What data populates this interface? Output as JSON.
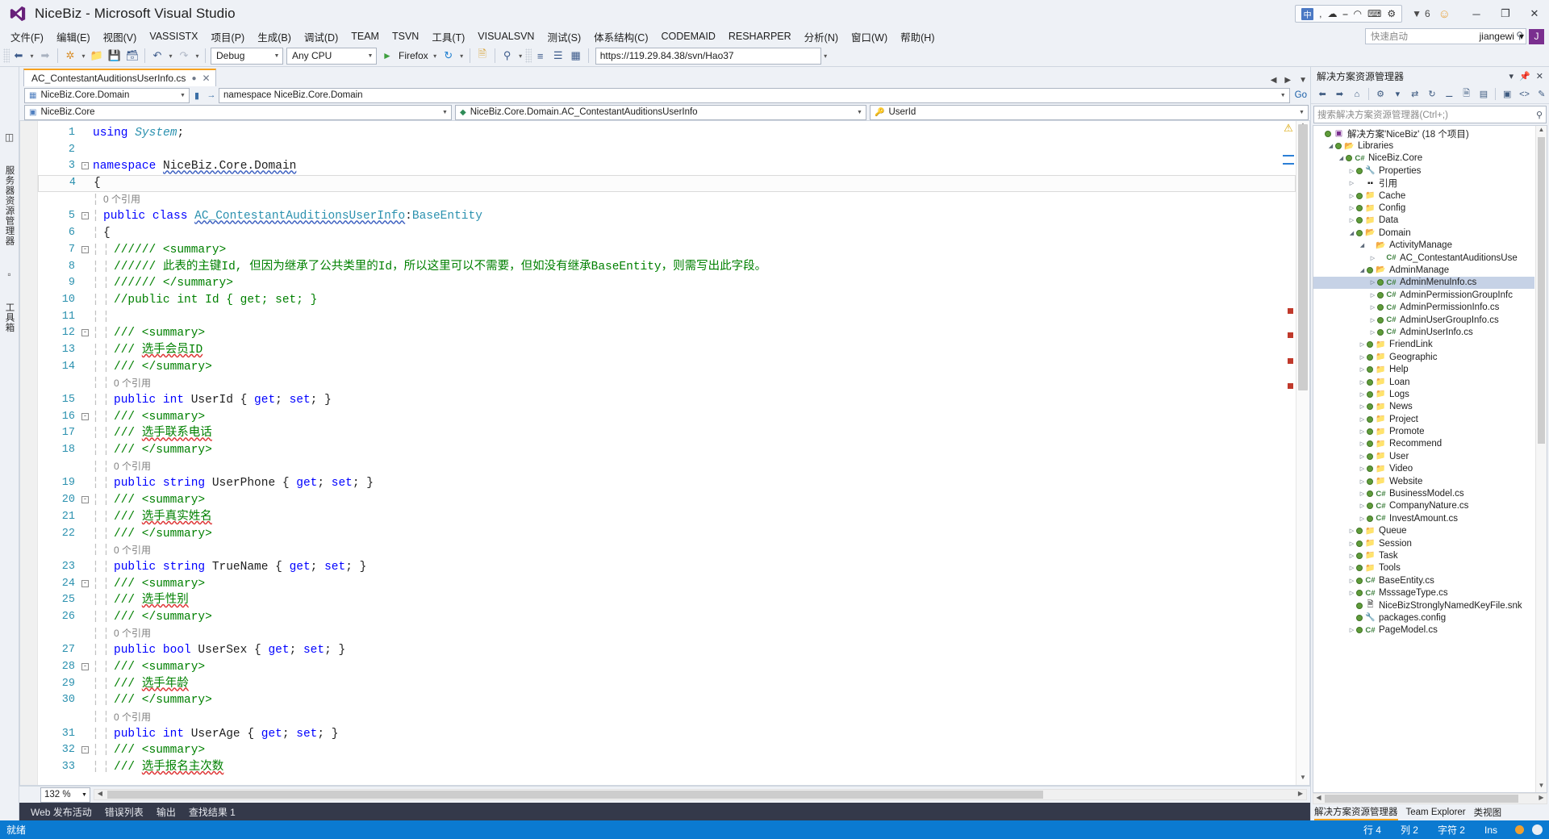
{
  "window": {
    "title": "NiceBiz - Microsoft Visual Studio",
    "logo_icon": "visual-studio-logo",
    "notification_count": "6",
    "feedback_icon": "smiley-icon",
    "minimize_label": "─",
    "maximize_label": "❐",
    "close_label": "✕",
    "ime": {
      "lang_square": "中",
      "items": [
        "中",
        ",",
        "☁",
        "▭",
        "⌽",
        "⛃",
        "⌨"
      ]
    }
  },
  "menu": {
    "items": [
      "文件(F)",
      "编辑(E)",
      "视图(V)",
      "VASSISTX",
      "项目(P)",
      "生成(B)",
      "调试(D)",
      "TEAM",
      "TSVN",
      "工具(T)",
      "VISUALSVN",
      "测试(S)",
      "体系结构(C)",
      "CODEMAID",
      "RESHARPER",
      "分析(N)",
      "窗口(W)",
      "帮助(H)"
    ],
    "quick_launch_placeholder": "快速启动",
    "quick_launch_icon": "search-icon",
    "user_name": "jiangewi",
    "user_avatar_letter": "J",
    "user_caret": "▾"
  },
  "toolbar": {
    "back_icon": "navigate-back-icon",
    "forward_icon": "navigate-forward-icon",
    "new_project_icon": "new-project-icon",
    "open_icon": "open-file-icon",
    "save_icon": "save-icon",
    "save_all_icon": "save-all-icon",
    "undo_icon": "undo-icon",
    "redo_icon": "redo-icon",
    "config_value": "Debug",
    "platform_value": "Any CPU",
    "start_label": "Firefox",
    "start_icon": "run-play-icon",
    "refresh_icon": "refresh-icon",
    "url_value": "https://119.29.84.38/svn/Hao37",
    "misc_icons": [
      "step-icon",
      "find-icon",
      "comment-icon",
      "uncomment-icon",
      "indent-icon",
      "outdent-icon",
      "bookmark-icon",
      "panel-icon",
      "grid-icon"
    ]
  },
  "leftrail": {
    "items": [
      {
        "label": "服务器资源管理器",
        "icon": "server-explorer-icon"
      },
      {
        "label": "工具箱",
        "icon": "toolbox-icon"
      }
    ]
  },
  "tabs": {
    "active": {
      "label": "AC_ContestantAuditionsUserInfo.cs",
      "pin_icon": "pin-icon",
      "close_icon": "close-icon"
    },
    "right_controls": [
      "scroll-left-icon",
      "scroll-right-icon",
      "tab-list-icon"
    ]
  },
  "navbars": {
    "project_value": "NiceBiz.Core.Domain",
    "project_icon": "project-icon",
    "member_value": "namespace NiceBiz.Core.Domain",
    "member_arrow": "→",
    "go_label": "Go",
    "scope_value": "NiceBiz.Core",
    "scope_icon": "assembly-icon",
    "type_value": "NiceBiz.Core.Domain.AC_ContestantAuditionsUserInfo",
    "type_icon": "class-icon",
    "symbol_value": "UserId",
    "symbol_icon": "property-icon"
  },
  "editor": {
    "zoom_level": "132 %",
    "lines": [
      {
        "n": "1",
        "fold": "",
        "indent": 0,
        "tokens": [
          {
            "t": "using ",
            "c": "kw"
          },
          {
            "t": "System",
            "c": "typ ital"
          },
          {
            "t": ";",
            "c": "usr"
          }
        ]
      },
      {
        "n": "2",
        "fold": "",
        "indent": 0,
        "tokens": []
      },
      {
        "n": "3",
        "fold": "-",
        "indent": 0,
        "tokens": [
          {
            "t": "namespace ",
            "c": "kw"
          },
          {
            "t": "NiceBiz.Core.Domain",
            "c": "usr squiggle"
          }
        ]
      },
      {
        "n": "4",
        "fold": "",
        "indent": 0,
        "tokens": [
          {
            "t": "{",
            "c": "usr"
          }
        ],
        "current": true
      },
      {
        "n": "",
        "fold": "",
        "indent": 1,
        "ref": "0 个引用"
      },
      {
        "n": "5",
        "fold": "-",
        "indent": 1,
        "tokens": [
          {
            "t": "public class ",
            "c": "kw"
          },
          {
            "t": "AC_ContestantAuditionsUserInfo",
            "c": "typ squiggle"
          },
          {
            "t": ":",
            "c": "usr"
          },
          {
            "t": "BaseEntity",
            "c": "typ"
          }
        ]
      },
      {
        "n": "6",
        "fold": "",
        "indent": 1,
        "tokens": [
          {
            "t": "{",
            "c": "usr"
          }
        ]
      },
      {
        "n": "7",
        "fold": "-",
        "indent": 2,
        "tokens": [
          {
            "t": "////// <summary>",
            "c": "cmt"
          }
        ]
      },
      {
        "n": "8",
        "fold": "",
        "indent": 2,
        "tokens": [
          {
            "t": "////// 此表的主键Id, 但因为继承了公共类里的Id，所以这里可以不需要，但如没有继承BaseEntity，则需写出此字段。",
            "c": "cmt"
          }
        ]
      },
      {
        "n": "9",
        "fold": "",
        "indent": 2,
        "tokens": [
          {
            "t": "////// </summary>",
            "c": "cmt"
          }
        ]
      },
      {
        "n": "10",
        "fold": "",
        "indent": 2,
        "tokens": [
          {
            "t": "//public int Id { get; set; }",
            "c": "cmt"
          }
        ]
      },
      {
        "n": "11",
        "fold": "",
        "indent": 2,
        "tokens": []
      },
      {
        "n": "12",
        "fold": "-",
        "indent": 2,
        "tokens": [
          {
            "t": "/// <summary>",
            "c": "cmt"
          }
        ]
      },
      {
        "n": "13",
        "fold": "",
        "indent": 2,
        "tokens": [
          {
            "t": "/// ",
            "c": "cmt"
          },
          {
            "t": "选手会员ID",
            "c": "cmt squiggle-red"
          }
        ]
      },
      {
        "n": "14",
        "fold": "",
        "indent": 2,
        "tokens": [
          {
            "t": "/// </summary>",
            "c": "cmt"
          }
        ]
      },
      {
        "n": "",
        "fold": "",
        "indent": 2,
        "ref": "0 个引用"
      },
      {
        "n": "15",
        "fold": "",
        "indent": 2,
        "tokens": [
          {
            "t": "public int ",
            "c": "kw"
          },
          {
            "t": "UserId",
            "c": "usr"
          },
          {
            "t": " { ",
            "c": "usr"
          },
          {
            "t": "get",
            "c": "kw"
          },
          {
            "t": "; ",
            "c": "usr"
          },
          {
            "t": "set",
            "c": "kw"
          },
          {
            "t": "; }",
            "c": "usr"
          }
        ]
      },
      {
        "n": "16",
        "fold": "-",
        "indent": 2,
        "tokens": [
          {
            "t": "/// <summary>",
            "c": "cmt"
          }
        ]
      },
      {
        "n": "17",
        "fold": "",
        "indent": 2,
        "tokens": [
          {
            "t": "/// ",
            "c": "cmt"
          },
          {
            "t": "选手联系电话",
            "c": "cmt squiggle-red"
          }
        ]
      },
      {
        "n": "18",
        "fold": "",
        "indent": 2,
        "tokens": [
          {
            "t": "/// </summary>",
            "c": "cmt"
          }
        ]
      },
      {
        "n": "",
        "fold": "",
        "indent": 2,
        "ref": "0 个引用"
      },
      {
        "n": "19",
        "fold": "",
        "indent": 2,
        "tokens": [
          {
            "t": "public string ",
            "c": "kw"
          },
          {
            "t": "UserPhone",
            "c": "usr"
          },
          {
            "t": " { ",
            "c": "usr"
          },
          {
            "t": "get",
            "c": "kw"
          },
          {
            "t": "; ",
            "c": "usr"
          },
          {
            "t": "set",
            "c": "kw"
          },
          {
            "t": "; }",
            "c": "usr"
          }
        ]
      },
      {
        "n": "20",
        "fold": "-",
        "indent": 2,
        "tokens": [
          {
            "t": "/// <summary>",
            "c": "cmt"
          }
        ]
      },
      {
        "n": "21",
        "fold": "",
        "indent": 2,
        "tokens": [
          {
            "t": "/// ",
            "c": "cmt"
          },
          {
            "t": "选手真实姓名",
            "c": "cmt squiggle-red"
          }
        ]
      },
      {
        "n": "22",
        "fold": "",
        "indent": 2,
        "tokens": [
          {
            "t": "/// </summary>",
            "c": "cmt"
          }
        ]
      },
      {
        "n": "",
        "fold": "",
        "indent": 2,
        "ref": "0 个引用"
      },
      {
        "n": "23",
        "fold": "",
        "indent": 2,
        "tokens": [
          {
            "t": "public string ",
            "c": "kw"
          },
          {
            "t": "TrueName",
            "c": "usr"
          },
          {
            "t": " { ",
            "c": "usr"
          },
          {
            "t": "get",
            "c": "kw"
          },
          {
            "t": "; ",
            "c": "usr"
          },
          {
            "t": "set",
            "c": "kw"
          },
          {
            "t": "; }",
            "c": "usr"
          }
        ]
      },
      {
        "n": "24",
        "fold": "-",
        "indent": 2,
        "tokens": [
          {
            "t": "/// <summary>",
            "c": "cmt"
          }
        ]
      },
      {
        "n": "25",
        "fold": "",
        "indent": 2,
        "tokens": [
          {
            "t": "/// ",
            "c": "cmt"
          },
          {
            "t": "选手性别",
            "c": "cmt squiggle-red"
          }
        ]
      },
      {
        "n": "26",
        "fold": "",
        "indent": 2,
        "tokens": [
          {
            "t": "/// </summary>",
            "c": "cmt"
          }
        ]
      },
      {
        "n": "",
        "fold": "",
        "indent": 2,
        "ref": "0 个引用"
      },
      {
        "n": "27",
        "fold": "",
        "indent": 2,
        "tokens": [
          {
            "t": "public bool ",
            "c": "kw"
          },
          {
            "t": "UserSex",
            "c": "usr"
          },
          {
            "t": " { ",
            "c": "usr"
          },
          {
            "t": "get",
            "c": "kw"
          },
          {
            "t": "; ",
            "c": "usr"
          },
          {
            "t": "set",
            "c": "kw"
          },
          {
            "t": "; }",
            "c": "usr"
          }
        ]
      },
      {
        "n": "28",
        "fold": "-",
        "indent": 2,
        "tokens": [
          {
            "t": "/// <summary>",
            "c": "cmt"
          }
        ]
      },
      {
        "n": "29",
        "fold": "",
        "indent": 2,
        "tokens": [
          {
            "t": "/// ",
            "c": "cmt"
          },
          {
            "t": "选手年龄",
            "c": "cmt squiggle-red"
          }
        ]
      },
      {
        "n": "30",
        "fold": "",
        "indent": 2,
        "tokens": [
          {
            "t": "/// </summary>",
            "c": "cmt"
          }
        ]
      },
      {
        "n": "",
        "fold": "",
        "indent": 2,
        "ref": "0 个引用"
      },
      {
        "n": "31",
        "fold": "",
        "indent": 2,
        "tokens": [
          {
            "t": "public int ",
            "c": "kw"
          },
          {
            "t": "UserAge",
            "c": "usr"
          },
          {
            "t": " { ",
            "c": "usr"
          },
          {
            "t": "get",
            "c": "kw"
          },
          {
            "t": "; ",
            "c": "usr"
          },
          {
            "t": "set",
            "c": "kw"
          },
          {
            "t": "; }",
            "c": "usr"
          }
        ]
      },
      {
        "n": "32",
        "fold": "-",
        "indent": 2,
        "tokens": [
          {
            "t": "/// <summary>",
            "c": "cmt"
          }
        ]
      },
      {
        "n": "33",
        "fold": "",
        "indent": 2,
        "tokens": [
          {
            "t": "/// ",
            "c": "cmt"
          },
          {
            "t": "选手报名主次数",
            "c": "cmt squiggle-red"
          }
        ]
      }
    ]
  },
  "solution_explorer": {
    "title": "解决方案资源管理器",
    "header_tools": [
      "▾",
      "−",
      "✕"
    ],
    "toolbar_icons": [
      "back-icon",
      "forward-icon",
      "home-icon",
      "sync-icon",
      "refresh-icon",
      "collapse-all-icon",
      "show-all-files-icon",
      "properties-icon",
      "preview-icon",
      "code-view-icon",
      "designer-view-icon"
    ],
    "search_placeholder": "搜索解决方案资源管理器(Ctrl+;)",
    "search_icon": "search-icon",
    "tree": [
      {
        "depth": 0,
        "arrow": "",
        "dot": true,
        "icon": "solution-icon",
        "label": "解决方案'NiceBiz' (18 个项目)"
      },
      {
        "depth": 1,
        "arrow": "◢",
        "dot": true,
        "icon": "folder-open-icon",
        "label": "Libraries"
      },
      {
        "depth": 2,
        "arrow": "◢",
        "dot": true,
        "icon": "csproj-icon",
        "label": "NiceBiz.Core"
      },
      {
        "depth": 3,
        "arrow": "▷",
        "dot": true,
        "icon": "wrench-icon",
        "label": "Properties"
      },
      {
        "depth": 3,
        "arrow": "▷",
        "dot": false,
        "icon": "references-icon",
        "label": "引用"
      },
      {
        "depth": 3,
        "arrow": "▷",
        "dot": true,
        "icon": "folder-icon",
        "label": "Cache"
      },
      {
        "depth": 3,
        "arrow": "▷",
        "dot": true,
        "icon": "folder-icon",
        "label": "Config"
      },
      {
        "depth": 3,
        "arrow": "▷",
        "dot": true,
        "icon": "folder-icon",
        "label": "Data"
      },
      {
        "depth": 3,
        "arrow": "◢",
        "dot": true,
        "icon": "folder-open-icon",
        "label": "Domain"
      },
      {
        "depth": 4,
        "arrow": "◢",
        "dot": false,
        "icon": "folder-open-icon",
        "label": "ActivityManage"
      },
      {
        "depth": 5,
        "arrow": "▷",
        "dot": false,
        "icon": "cs-icon",
        "label": "AC_ContestantAuditionsUse"
      },
      {
        "depth": 4,
        "arrow": "◢",
        "dot": true,
        "icon": "folder-open-icon",
        "label": "AdminManage"
      },
      {
        "depth": 5,
        "arrow": "▷",
        "dot": true,
        "icon": "cs-icon",
        "label": "AdminMenuInfo.cs",
        "selected": true
      },
      {
        "depth": 5,
        "arrow": "▷",
        "dot": true,
        "icon": "cs-icon",
        "label": "AdminPermissionGroupInfc"
      },
      {
        "depth": 5,
        "arrow": "▷",
        "dot": true,
        "icon": "cs-icon",
        "label": "AdminPermissionInfo.cs"
      },
      {
        "depth": 5,
        "arrow": "▷",
        "dot": true,
        "icon": "cs-icon",
        "label": "AdminUserGroupInfo.cs"
      },
      {
        "depth": 5,
        "arrow": "▷",
        "dot": true,
        "icon": "cs-icon",
        "label": "AdminUserInfo.cs"
      },
      {
        "depth": 4,
        "arrow": "▷",
        "dot": true,
        "icon": "folder-icon",
        "label": "FriendLink"
      },
      {
        "depth": 4,
        "arrow": "▷",
        "dot": true,
        "icon": "folder-icon",
        "label": "Geographic"
      },
      {
        "depth": 4,
        "arrow": "▷",
        "dot": true,
        "icon": "folder-icon",
        "label": "Help"
      },
      {
        "depth": 4,
        "arrow": "▷",
        "dot": true,
        "icon": "folder-icon",
        "label": "Loan"
      },
      {
        "depth": 4,
        "arrow": "▷",
        "dot": true,
        "icon": "folder-icon",
        "label": "Logs"
      },
      {
        "depth": 4,
        "arrow": "▷",
        "dot": true,
        "icon": "folder-icon",
        "label": "News"
      },
      {
        "depth": 4,
        "arrow": "▷",
        "dot": true,
        "icon": "folder-icon",
        "label": "Project"
      },
      {
        "depth": 4,
        "arrow": "▷",
        "dot": true,
        "icon": "folder-icon",
        "label": "Promote"
      },
      {
        "depth": 4,
        "arrow": "▷",
        "dot": true,
        "icon": "folder-icon",
        "label": "Recommend"
      },
      {
        "depth": 4,
        "arrow": "▷",
        "dot": true,
        "icon": "folder-icon",
        "label": "User"
      },
      {
        "depth": 4,
        "arrow": "▷",
        "dot": true,
        "icon": "folder-icon",
        "label": "Video"
      },
      {
        "depth": 4,
        "arrow": "▷",
        "dot": true,
        "icon": "folder-icon",
        "label": "Website"
      },
      {
        "depth": 4,
        "arrow": "▷",
        "dot": true,
        "icon": "cs-icon",
        "label": "BusinessModel.cs"
      },
      {
        "depth": 4,
        "arrow": "▷",
        "dot": true,
        "icon": "cs-icon",
        "label": "CompanyNature.cs"
      },
      {
        "depth": 4,
        "arrow": "▷",
        "dot": true,
        "icon": "cs-icon",
        "label": "InvestAmount.cs"
      },
      {
        "depth": 3,
        "arrow": "▷",
        "dot": true,
        "icon": "folder-icon",
        "label": "Queue"
      },
      {
        "depth": 3,
        "arrow": "▷",
        "dot": true,
        "icon": "folder-icon",
        "label": "Session"
      },
      {
        "depth": 3,
        "arrow": "▷",
        "dot": true,
        "icon": "folder-icon",
        "label": "Task"
      },
      {
        "depth": 3,
        "arrow": "▷",
        "dot": true,
        "icon": "folder-icon",
        "label": "Tools"
      },
      {
        "depth": 3,
        "arrow": "▷",
        "dot": true,
        "icon": "cs-icon",
        "label": "BaseEntity.cs"
      },
      {
        "depth": 3,
        "arrow": "▷",
        "dot": true,
        "icon": "cs-icon",
        "label": "MsssageType.cs"
      },
      {
        "depth": 3,
        "arrow": "",
        "dot": true,
        "icon": "snk-icon",
        "label": "NiceBizStronglyNamedKeyFile.snk"
      },
      {
        "depth": 3,
        "arrow": "",
        "dot": true,
        "icon": "config-icon",
        "label": "packages.config"
      },
      {
        "depth": 3,
        "arrow": "▷",
        "dot": true,
        "icon": "cs-icon",
        "label": "PageModel.cs"
      }
    ],
    "panel_tabs": [
      {
        "label": "解决方案资源管理器",
        "active": true
      },
      {
        "label": "Team Explorer",
        "active": false
      },
      {
        "label": "类视图",
        "active": false
      }
    ]
  },
  "bottom_tabs": [
    "Web 发布活动",
    "错误列表",
    "输出",
    "查找结果 1"
  ],
  "statusbar": {
    "status": "就绪",
    "line": "行 4",
    "column": "列 2",
    "character": "字符 2",
    "insert_mode": "Ins"
  },
  "colors": {
    "accent": "#0b7ad1",
    "tab_accent": "#f7a21e",
    "keyword": "#0000ff",
    "type": "#2b91af",
    "comment": "#008000",
    "chrome": "#eef1f6"
  }
}
